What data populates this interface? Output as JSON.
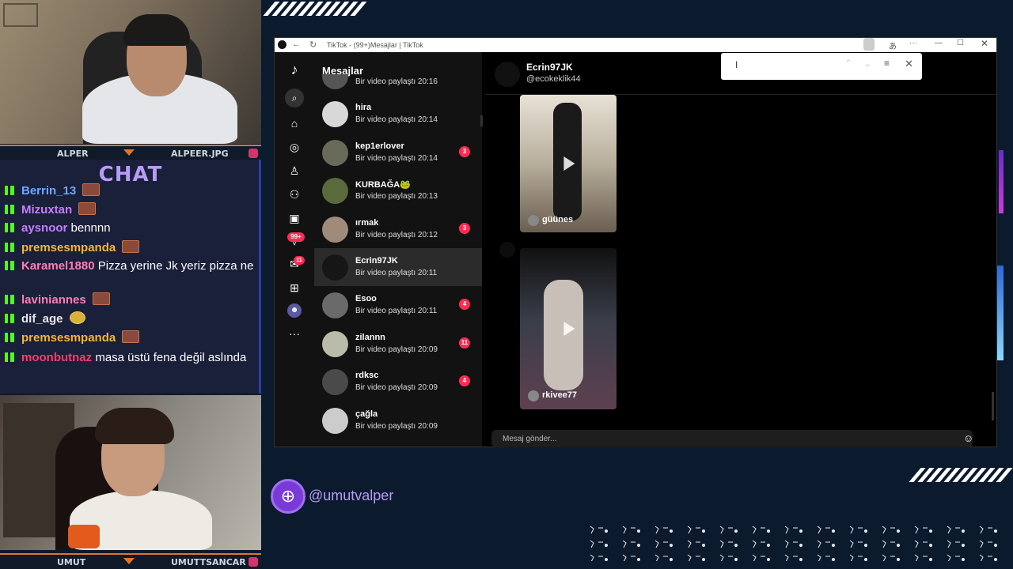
{
  "overlay": {
    "cam1": {
      "left_label": "ALPER",
      "right_label": "ALPEER.JPG"
    },
    "cam2": {
      "left_label": "UMUT",
      "right_label": "UMUTTSANCAR"
    },
    "handle": "@umutvalper",
    "colors": {
      "background": "#0c1a2e",
      "accent": "#e0752b",
      "chat_title": "#b79cf7",
      "kick_green": "#53fc18"
    }
  },
  "chat": {
    "title": "CHAT",
    "messages": [
      {
        "user": "Berrin_13",
        "color": "#6fa8ff",
        "text": "",
        "emote": "emote-icon"
      },
      {
        "user": "Mizuxtan",
        "color": "#c77dff",
        "text": "",
        "emote": "emote-icon"
      },
      {
        "user": "aysnoor",
        "color": "#c77dff",
        "text": "bennnn",
        "emote": ""
      },
      {
        "user": "premsesmpanda",
        "color": "#f5b53c",
        "text": "",
        "emote": "emote-icon"
      },
      {
        "user": "Karamel1880",
        "color": "#ff7eb6",
        "text": "Pizza yerine Jk yeriz pizza ne",
        "emote": ""
      },
      {
        "user": "laviniannes",
        "color": "#ff7eb6",
        "text": "",
        "emote": "emote-icon"
      },
      {
        "user": "dif_age",
        "color": "#e8e8e8",
        "text": "",
        "emote": "clap-emote-icon"
      },
      {
        "user": "premsesmpanda",
        "color": "#f5b53c",
        "text": "",
        "emote": "emote-icon"
      },
      {
        "user": "moonbutnaz",
        "color": "#ff3b6b",
        "text": "masa üstü fena değil aslında",
        "emote": ""
      }
    ]
  },
  "browser": {
    "window_title": "TikTok - (99+)Mesajlar | TikTok",
    "sidebar_badges": {
      "inbox": "99+",
      "messages": "11"
    },
    "panel_title": "Mesajlar",
    "conversations": [
      {
        "name": "",
        "preview": "Bir video paylaştı 20:16",
        "badge": "",
        "avatar": "#555"
      },
      {
        "name": "hira",
        "preview": "Bir video paylaştı 20:14",
        "badge": "",
        "avatar": "#d8d8d8"
      },
      {
        "name": "kep1erlover",
        "preview": "Bir video paylaştı 20:14",
        "badge": "3",
        "avatar": "#6a6a5a"
      },
      {
        "name": "KURBAĞA🐸",
        "preview": "Bir video paylaştı 20:13",
        "badge": "",
        "avatar": "#5a6a3a"
      },
      {
        "name": "ırmak",
        "preview": "Bir video paylaştı 20:12",
        "badge": "3",
        "avatar": "#a08a7a"
      },
      {
        "name": "Ecrin97JK",
        "preview": "Bir video paylaştı 20:11",
        "badge": "",
        "avatar": "#161616"
      },
      {
        "name": "Esoo",
        "preview": "Bir video paylaştı 20:11",
        "badge": "4",
        "avatar": "#6a6a6a"
      },
      {
        "name": "zilannn",
        "preview": "Bir video paylaştı 20:09",
        "badge": "11",
        "avatar": "#bba"
      },
      {
        "name": "rdksc",
        "preview": "Bir video paylaştı 20:09",
        "badge": "4",
        "avatar": "#4a4a4a"
      },
      {
        "name": "çağla",
        "preview": "Bir video paylaştı 20:09",
        "badge": "",
        "avatar": "#ccc"
      }
    ],
    "chat_header": {
      "name": "Ecrin97JK",
      "handle": "@ecokeklik44"
    },
    "videos": [
      {
        "caption": "güünes"
      },
      {
        "caption": "rkivee77"
      }
    ],
    "input_placeholder": "Mesaj gönder..."
  }
}
